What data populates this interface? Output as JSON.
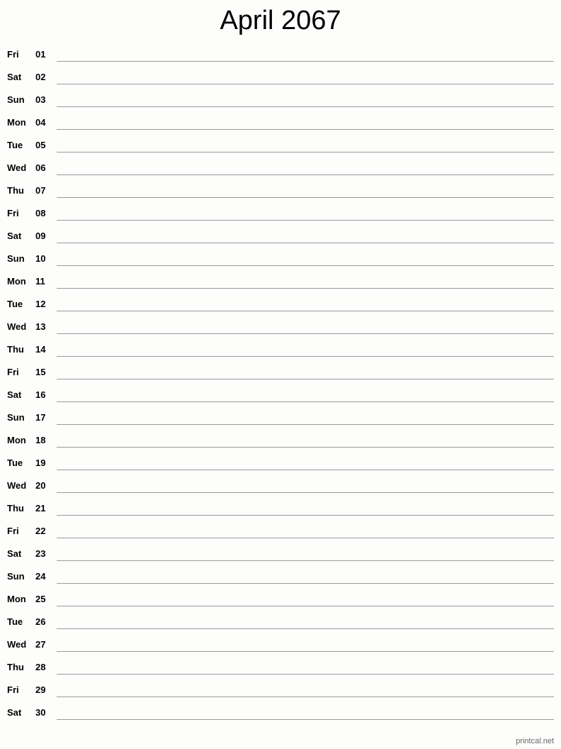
{
  "title": "April 2067",
  "days": [
    {
      "dow": "Fri",
      "day": "01"
    },
    {
      "dow": "Sat",
      "day": "02"
    },
    {
      "dow": "Sun",
      "day": "03"
    },
    {
      "dow": "Mon",
      "day": "04"
    },
    {
      "dow": "Tue",
      "day": "05"
    },
    {
      "dow": "Wed",
      "day": "06"
    },
    {
      "dow": "Thu",
      "day": "07"
    },
    {
      "dow": "Fri",
      "day": "08"
    },
    {
      "dow": "Sat",
      "day": "09"
    },
    {
      "dow": "Sun",
      "day": "10"
    },
    {
      "dow": "Mon",
      "day": "11"
    },
    {
      "dow": "Tue",
      "day": "12"
    },
    {
      "dow": "Wed",
      "day": "13"
    },
    {
      "dow": "Thu",
      "day": "14"
    },
    {
      "dow": "Fri",
      "day": "15"
    },
    {
      "dow": "Sat",
      "day": "16"
    },
    {
      "dow": "Sun",
      "day": "17"
    },
    {
      "dow": "Mon",
      "day": "18"
    },
    {
      "dow": "Tue",
      "day": "19"
    },
    {
      "dow": "Wed",
      "day": "20"
    },
    {
      "dow": "Thu",
      "day": "21"
    },
    {
      "dow": "Fri",
      "day": "22"
    },
    {
      "dow": "Sat",
      "day": "23"
    },
    {
      "dow": "Sun",
      "day": "24"
    },
    {
      "dow": "Mon",
      "day": "25"
    },
    {
      "dow": "Tue",
      "day": "26"
    },
    {
      "dow": "Wed",
      "day": "27"
    },
    {
      "dow": "Thu",
      "day": "28"
    },
    {
      "dow": "Fri",
      "day": "29"
    },
    {
      "dow": "Sat",
      "day": "30"
    }
  ],
  "footer": "printcal.net"
}
